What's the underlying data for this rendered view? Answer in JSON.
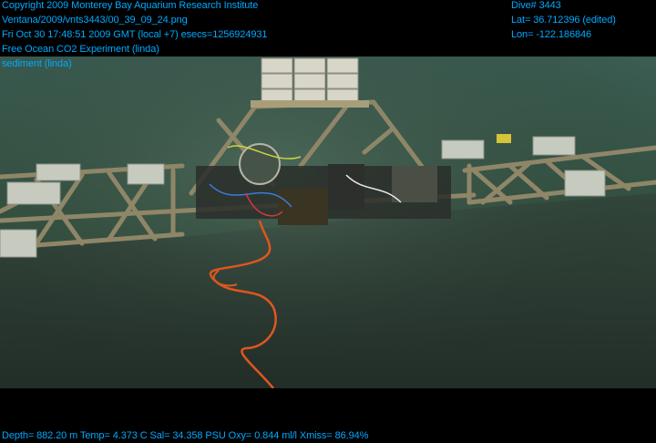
{
  "overlay": {
    "header_lines": [
      "Copyright 2009 Monterey Bay Aquarium Research Institute",
      "Ventana/2009/vnts3443/00_39_09_24.png",
      "Fri Oct 30 17:48:51 2009 GMT (local +7)  esecs=1256924931",
      "Free Ocean CO2 Experiment (linda)",
      "sediment (linda)"
    ],
    "dive": "Dive# 3443",
    "lat": "Lat= 36.712396 (edited)",
    "lon": "Lon= -122.186846",
    "telemetry": "Depth= 882.20 m  Temp= 4.373 C  Sal= 34.358 PSU  Oxy= 0.844 ml/l  Xmiss= 86.94%"
  },
  "colors": {
    "overlay_text": "#00aaff",
    "water": "#3a5a4c",
    "seafloor": "#27362e",
    "frame_wood": "#9a8f70",
    "cable": "#e0561f"
  }
}
